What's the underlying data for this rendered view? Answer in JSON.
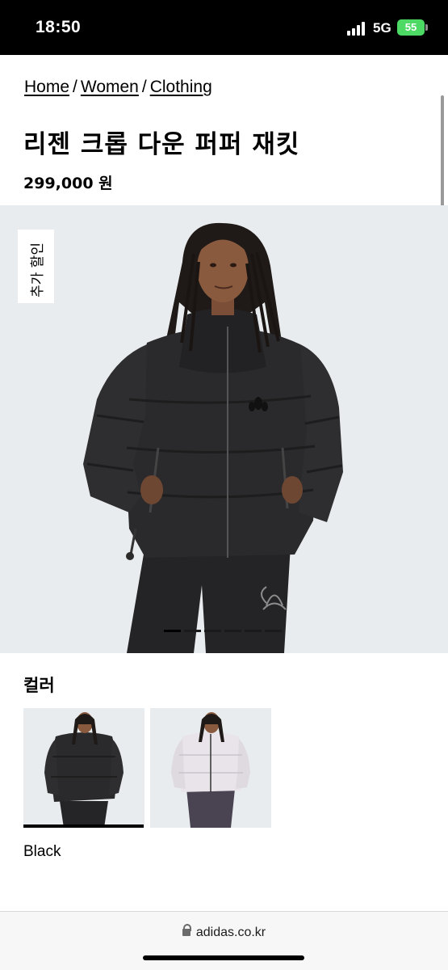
{
  "status_bar": {
    "time": "18:50",
    "network": "5G",
    "battery": "55"
  },
  "breadcrumb": [
    {
      "label": "Home"
    },
    {
      "label": "Women"
    },
    {
      "label": "Clothing"
    }
  ],
  "breadcrumb_separator": "/",
  "product": {
    "title": "리젠 크롭 다운 퍼퍼 재킷",
    "price": "299,000 원",
    "badge": "추가 할인",
    "carousel": {
      "total": 6,
      "active_index": 0
    }
  },
  "colors": {
    "label": "컬러",
    "options": [
      {
        "name": "Black",
        "selected": true
      },
      {
        "name": "White",
        "selected": false
      }
    ],
    "selected_name": "Black"
  },
  "browser": {
    "url": "adidas.co.kr"
  },
  "icons": [
    "signal-icon",
    "battery-icon",
    "lock-icon",
    "adidas-trefoil-icon"
  ],
  "palette": {
    "jacket": "#2a2a2c",
    "hero_bg": "#e9ecee",
    "battery": "#4cd964"
  }
}
